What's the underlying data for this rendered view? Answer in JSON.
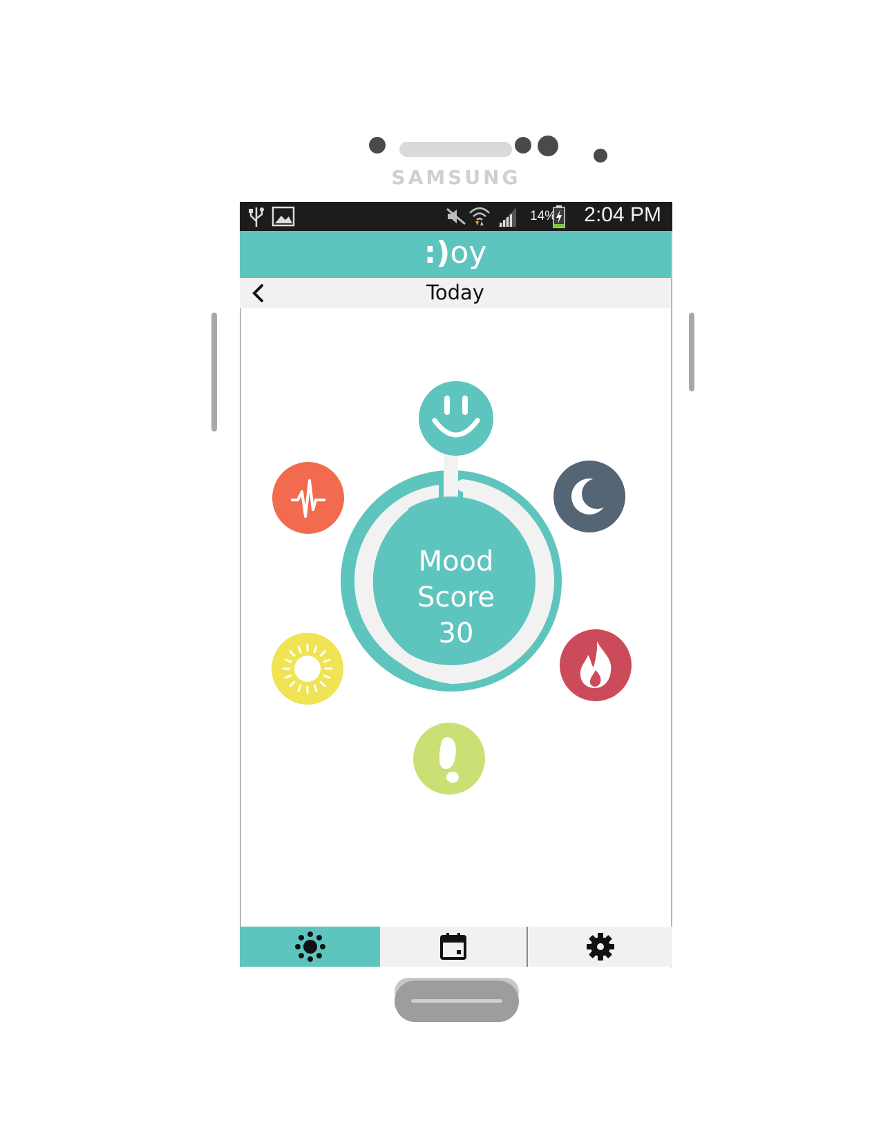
{
  "device": {
    "brand": "SAMSUNG"
  },
  "status_bar": {
    "battery_percent": "14%",
    "time": "2:04 PM"
  },
  "app": {
    "logo_face": ":)",
    "logo_text": "oy"
  },
  "date_bar": {
    "title": "Today"
  },
  "mood": {
    "label_line1": "Mood",
    "label_line2": "Score",
    "value": "30"
  },
  "colors": {
    "accent": "#5ec5be",
    "heart_rate": "#f26b4e",
    "sleep": "#546575",
    "sun": "#f0e354",
    "calories": "#cc4b5a",
    "steps": "#cbe074"
  },
  "nav": {
    "tabs": [
      {
        "icon": "dashboard-icon",
        "active": true
      },
      {
        "icon": "calendar-icon",
        "active": false
      },
      {
        "icon": "settings-icon",
        "active": false
      }
    ]
  }
}
